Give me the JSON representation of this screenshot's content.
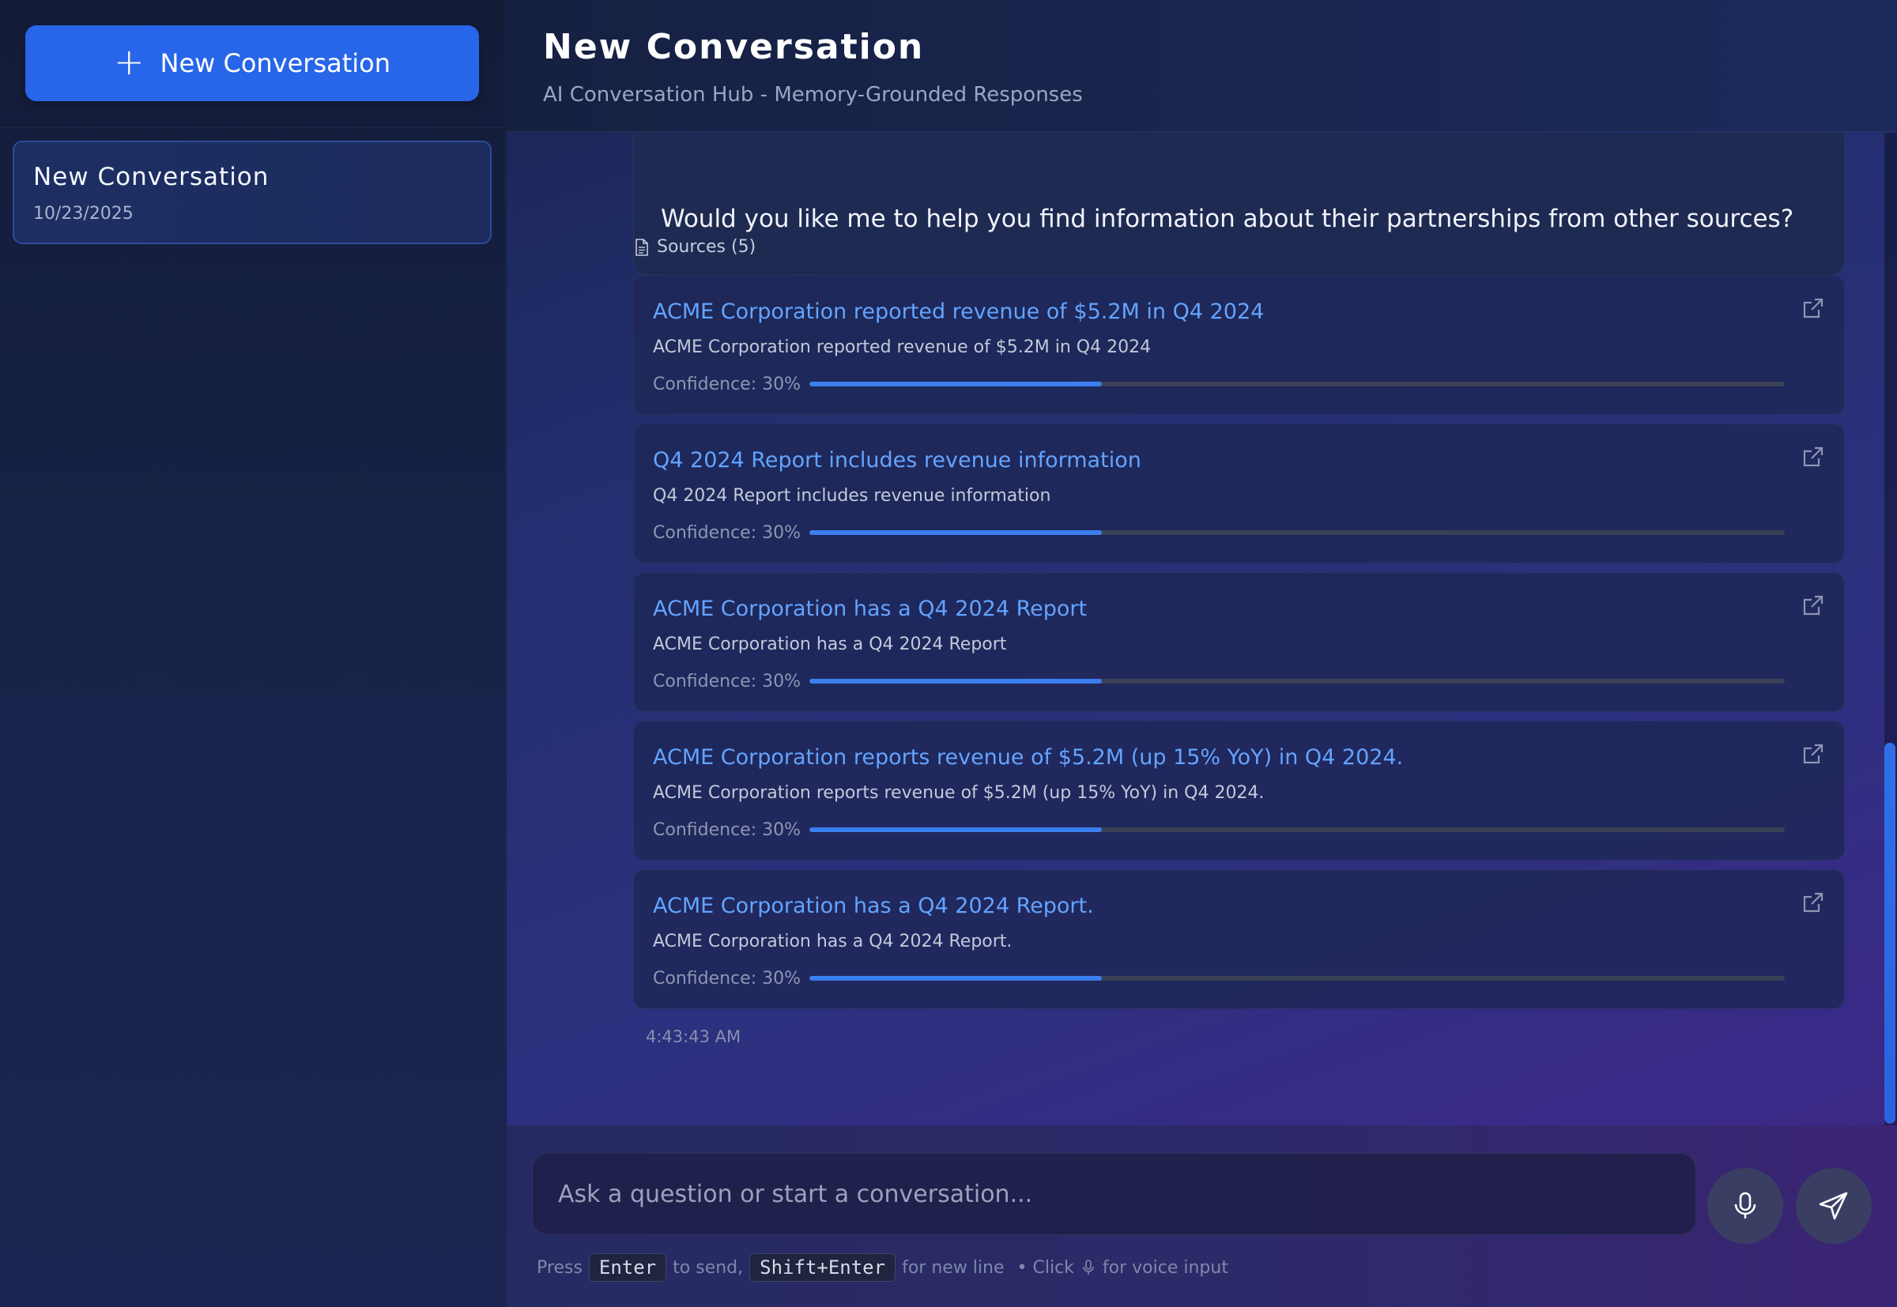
{
  "sidebar": {
    "new_button_label": "New Conversation",
    "conversations": [
      {
        "title": "New Conversation",
        "date": "10/23/2025"
      }
    ]
  },
  "header": {
    "title": "New Conversation",
    "subtitle": "AI Conversation Hub - Memory-Grounded Responses"
  },
  "message": {
    "text": "Would you like me to help you find information about their partnerships from other sources?",
    "sources_label": "Sources (5)",
    "timestamp": "4:43:43 AM",
    "sources": [
      {
        "title": "ACME Corporation reported revenue of $5.2M in Q4 2024",
        "description": "ACME Corporation reported revenue of $5.2M in Q4 2024",
        "confidence_label": "Confidence: 30%",
        "confidence": 0.3
      },
      {
        "title": "Q4 2024 Report includes revenue information",
        "description": "Q4 2024 Report includes revenue information",
        "confidence_label": "Confidence: 30%",
        "confidence": 0.3
      },
      {
        "title": "ACME Corporation has a Q4 2024 Report",
        "description": "ACME Corporation has a Q4 2024 Report",
        "confidence_label": "Confidence: 30%",
        "confidence": 0.3
      },
      {
        "title": "ACME Corporation reports revenue of $5.2M (up 15% YoY) in Q4 2024.",
        "description": "ACME Corporation reports revenue of $5.2M (up 15% YoY) in Q4 2024.",
        "confidence_label": "Confidence: 30%",
        "confidence": 0.3
      },
      {
        "title": "ACME Corporation has a Q4 2024 Report.",
        "description": "ACME Corporation has a Q4 2024 Report.",
        "confidence_label": "Confidence: 30%",
        "confidence": 0.3
      }
    ]
  },
  "composer": {
    "placeholder": "Ask a question or start a conversation...",
    "hint_press": "Press",
    "hint_enter_key": "Enter",
    "hint_to_send": "to send,",
    "hint_shift_enter_key": "Shift+Enter",
    "hint_new_line": "for new line",
    "hint_click": "• Click",
    "hint_voice": "for voice input"
  },
  "colors": {
    "accent": "#2766e8",
    "link": "#63a4ff",
    "confidence_fill": "#3b7ff0"
  },
  "icons": {
    "new_button": "plus-icon",
    "sources": "document-icon",
    "source_link": "external-link-icon",
    "mic": "microphone-icon",
    "send": "send-icon"
  }
}
